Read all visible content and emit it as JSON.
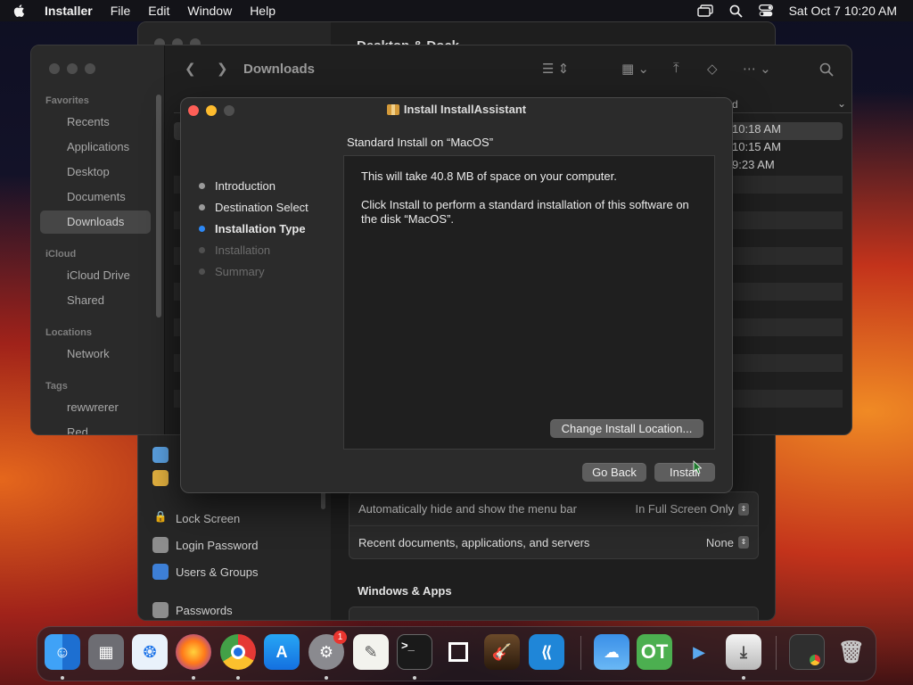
{
  "menubar": {
    "app_name": "Installer",
    "menus": [
      "File",
      "Edit",
      "Window",
      "Help"
    ],
    "datetime": "Sat Oct 7  10:20 AM"
  },
  "settings_window": {
    "title": "Desktop & Dock",
    "sidebar": [
      "Lock Screen",
      "Login Password",
      "Users & Groups",
      "Passwords"
    ],
    "rows": [
      {
        "label": "Automatically hide and show the menu bar",
        "value": "In Full Screen Only"
      },
      {
        "label": "Recent documents, applications, and servers",
        "value": "None"
      }
    ],
    "section": "Windows & Apps"
  },
  "finder": {
    "title": "Downloads",
    "sidebar": {
      "favorites_header": "Favorites",
      "favorites": [
        "Recents",
        "Applications",
        "Desktop",
        "Documents",
        "Downloads"
      ],
      "icloud_header": "iCloud",
      "icloud": [
        "iCloud Drive",
        "Shared"
      ],
      "locations_header": "Locations",
      "locations": [
        "Network"
      ],
      "tags_header": "Tags",
      "tags": [
        "rewwrerer",
        "Red"
      ]
    },
    "column_header_tail": "d",
    "times": [
      "10:18 AM",
      "10:15 AM",
      "9:23 AM"
    ]
  },
  "installer": {
    "window_title": "Install InstallAssistant",
    "heading": "Standard Install on “MacOS”",
    "steps": [
      {
        "label": "Introduction",
        "state": "done"
      },
      {
        "label": "Destination Select",
        "state": "done"
      },
      {
        "label": "Installation Type",
        "state": "current"
      },
      {
        "label": "Installation",
        "state": "future"
      },
      {
        "label": "Summary",
        "state": "future"
      }
    ],
    "message_1": "This will take 40.8 MB of space on your computer.",
    "message_2": "Click Install to perform a standard installation of this software on the disk “MacOS”.",
    "change_location_label": "Change Install Location...",
    "go_back_label": "Go Back",
    "install_label": "Install"
  },
  "dock": {
    "apps": [
      "finder",
      "launchpad",
      "safari",
      "firefox",
      "chrome",
      "app-store",
      "system-settings",
      "textedit",
      "terminal",
      "window-app",
      "garageband",
      "vscode",
      "weather",
      "ot-app",
      "instruments",
      "installer",
      "chrome-window",
      "trash"
    ],
    "settings_badge": "1",
    "colors": {
      "accent": "#2d88f5",
      "close": "#fe5f57",
      "minimize": "#febc2e"
    }
  }
}
